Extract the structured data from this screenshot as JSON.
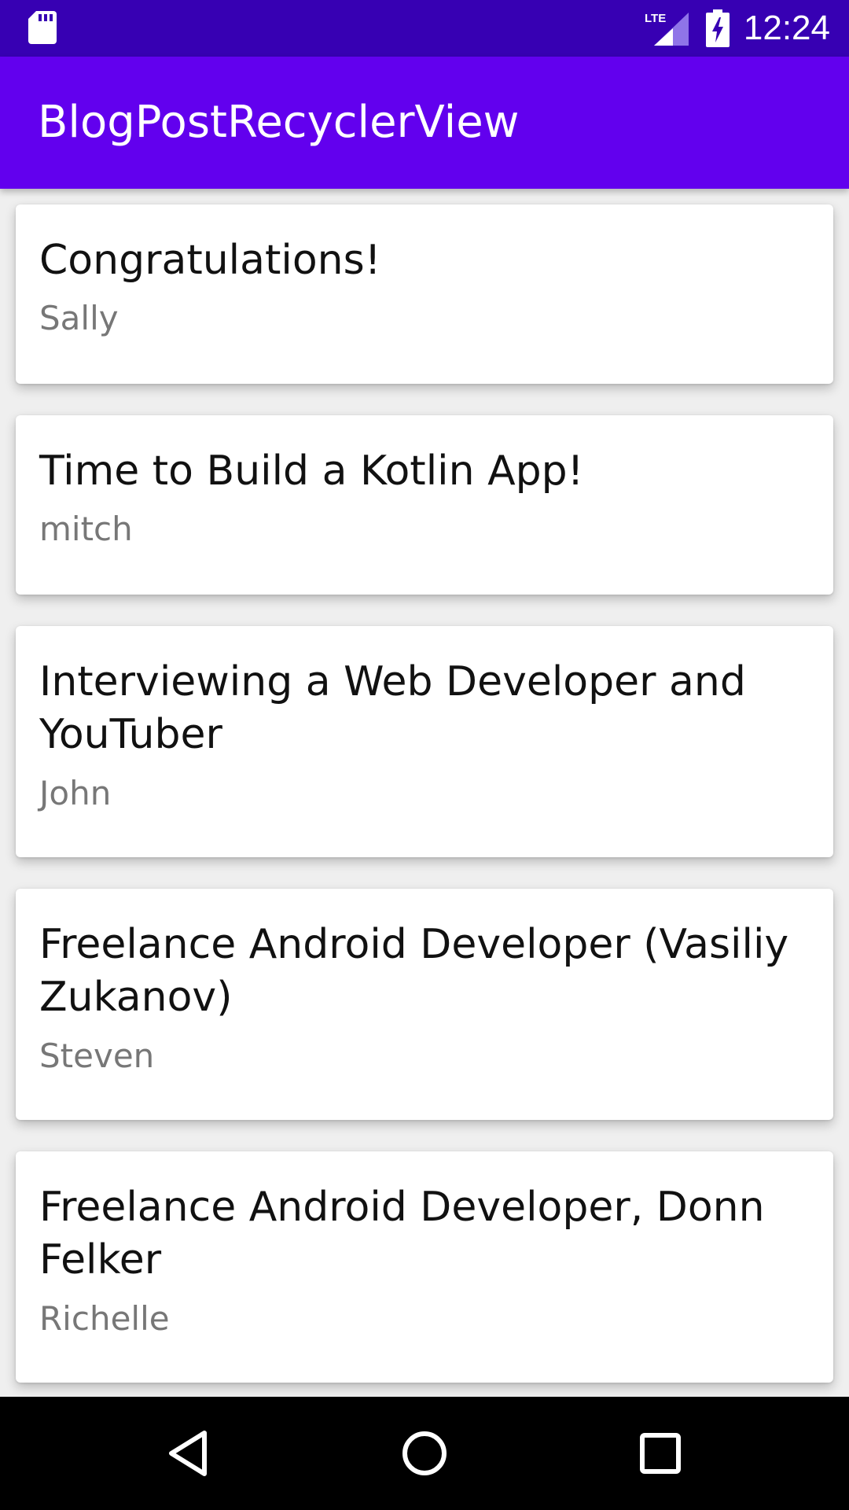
{
  "status_bar": {
    "time": "12:24",
    "network_label": "LTE",
    "icons": [
      "sd-card-icon",
      "lte-signal-icon",
      "battery-charging-icon"
    ],
    "background": "#3700b3"
  },
  "app_bar": {
    "title": "BlogPostRecyclerView",
    "background": "#6200ee"
  },
  "posts": [
    {
      "title": "Congratulations!",
      "author": "Sally"
    },
    {
      "title": "Time to Build a Kotlin App!",
      "author": "mitch"
    },
    {
      "title": "Interviewing a Web Developer and YouTuber",
      "author": "John"
    },
    {
      "title": "Freelance Android Developer (Vasiliy Zukanov)",
      "author": "Steven"
    },
    {
      "title": "Freelance Android Developer, Donn Felker",
      "author": "Richelle"
    }
  ],
  "nav_bar": {
    "buttons": [
      "back-icon",
      "home-icon",
      "recents-icon"
    ]
  }
}
